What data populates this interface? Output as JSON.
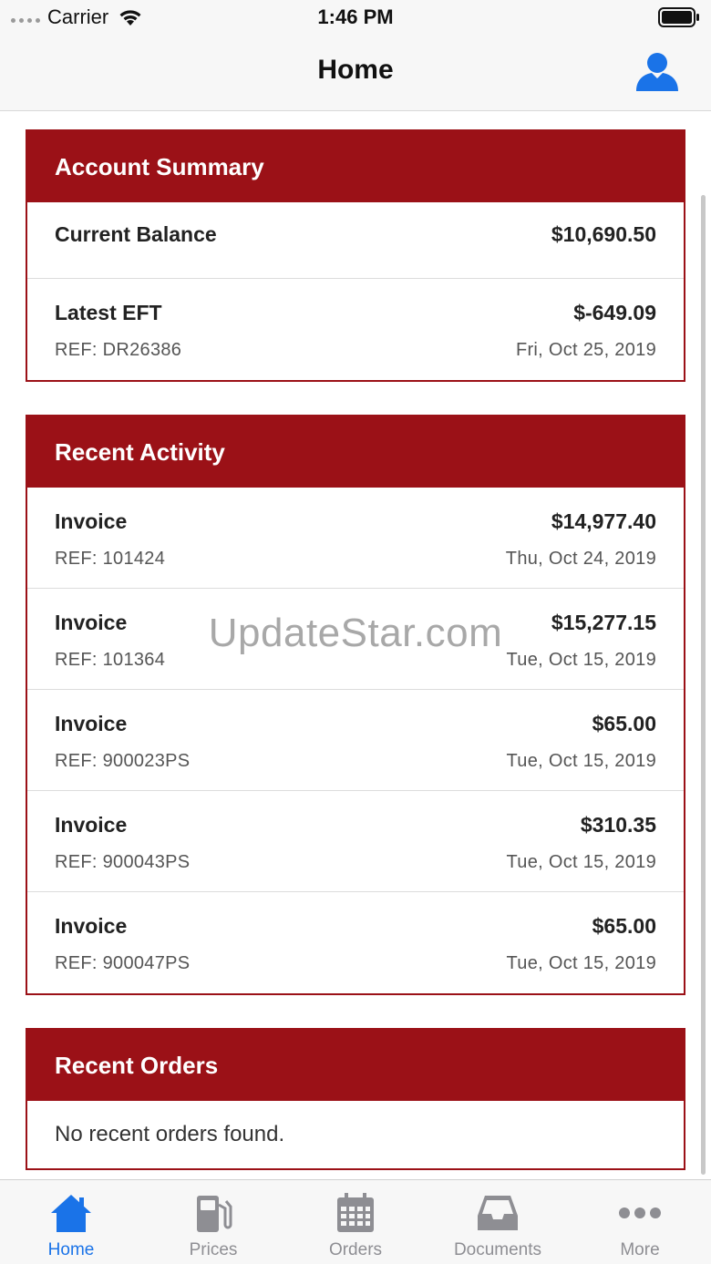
{
  "status_bar": {
    "carrier": "Carrier",
    "time": "1:46 PM"
  },
  "navbar": {
    "title": "Home",
    "profile_icon": "person-icon"
  },
  "account_summary": {
    "title": "Account Summary",
    "current_balance_label": "Current Balance",
    "current_balance_value": "$10,690.50",
    "latest_eft_label": "Latest EFT",
    "latest_eft_value": "$-649.09",
    "latest_eft_ref": "REF: DR26386",
    "latest_eft_date": "Fri, Oct 25, 2019"
  },
  "recent_activity": {
    "title": "Recent Activity",
    "items": [
      {
        "type": "Invoice",
        "amount": "$14,977.40",
        "ref": "REF: 101424",
        "date": "Thu, Oct 24, 2019"
      },
      {
        "type": "Invoice",
        "amount": "$15,277.15",
        "ref": "REF: 101364",
        "date": "Tue, Oct 15, 2019"
      },
      {
        "type": "Invoice",
        "amount": "$65.00",
        "ref": "REF: 900023PS",
        "date": "Tue, Oct 15, 2019"
      },
      {
        "type": "Invoice",
        "amount": "$310.35",
        "ref": "REF: 900043PS",
        "date": "Tue, Oct 15, 2019"
      },
      {
        "type": "Invoice",
        "amount": "$65.00",
        "ref": "REF: 900047PS",
        "date": "Tue, Oct 15, 2019"
      }
    ]
  },
  "recent_orders": {
    "title": "Recent Orders",
    "empty_message": "No recent orders found."
  },
  "watermark": "UpdateStar.com",
  "tabs": [
    {
      "label": "Home",
      "icon": "home-icon",
      "active": true
    },
    {
      "label": "Prices",
      "icon": "fuel-pump-icon",
      "active": false
    },
    {
      "label": "Orders",
      "icon": "calendar-icon",
      "active": false
    },
    {
      "label": "Documents",
      "icon": "inbox-tray-icon",
      "active": false
    },
    {
      "label": "More",
      "icon": "more-dots-icon",
      "active": false
    }
  ],
  "colors": {
    "brand_red": "#9b1117",
    "tab_active": "#1a73e8",
    "tab_inactive": "#8e8e93",
    "profile_blue": "#1a73e8"
  }
}
